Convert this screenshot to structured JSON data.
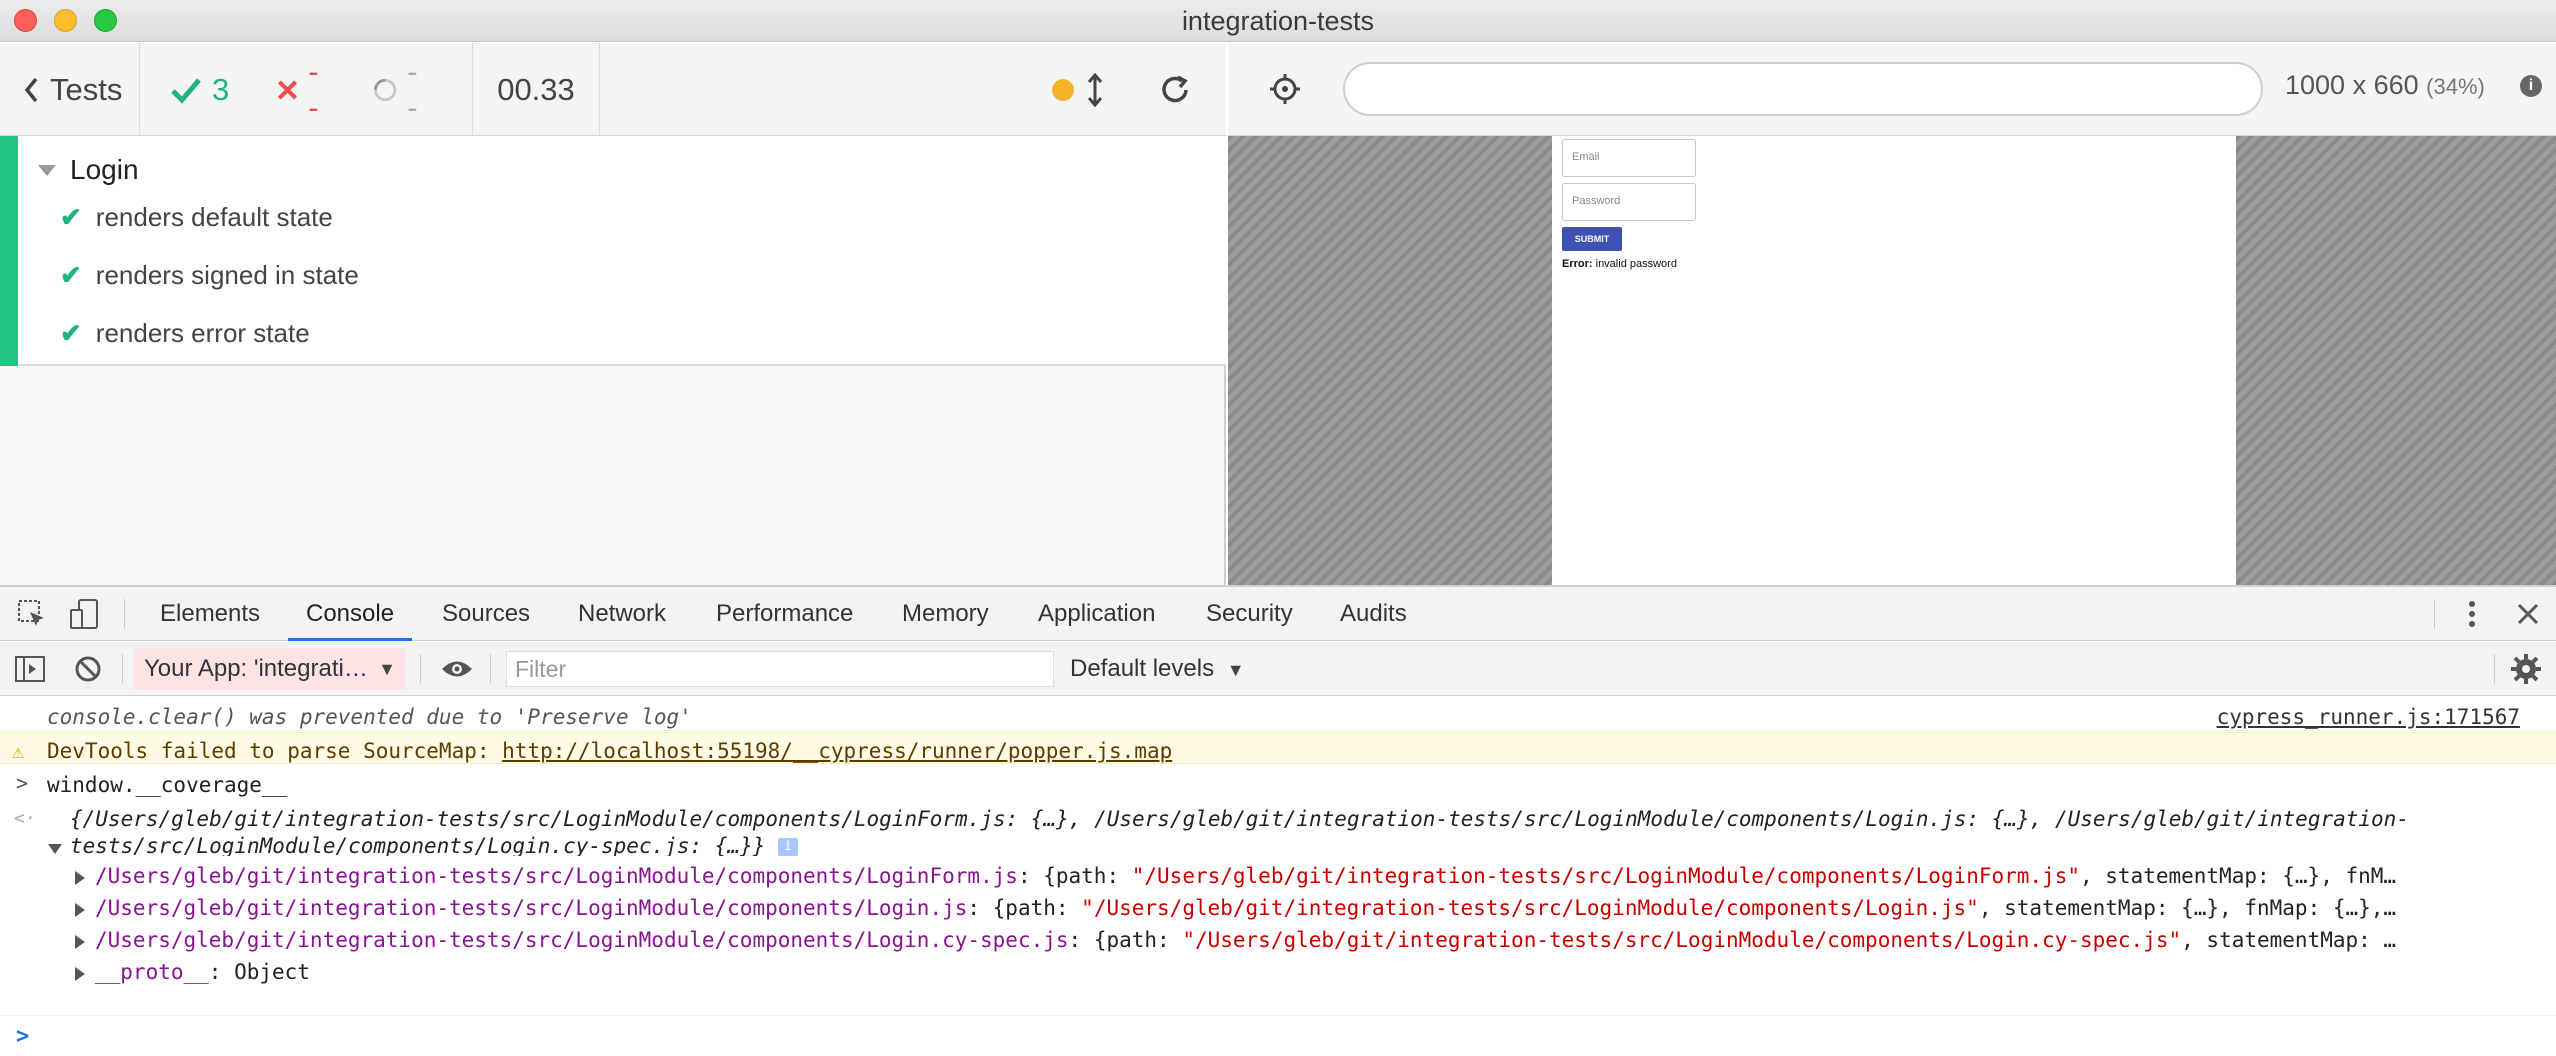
{
  "window": {
    "title": "integration-tests"
  },
  "reporter": {
    "back_label": "Tests",
    "passed": "3",
    "failed": "--",
    "pending": "--",
    "duration": "00.33",
    "suite": {
      "title": "Login",
      "tests": [
        "renders default state",
        "renders signed in state",
        "renders error state"
      ]
    }
  },
  "aut": {
    "url": "",
    "viewport": "1000 x 660",
    "scale": "(34%)",
    "app": {
      "email_placeholder": "Email",
      "password_placeholder": "Password",
      "submit_label": "SUBMIT",
      "error_label": "Error:",
      "error_text": "invalid password"
    }
  },
  "devtools": {
    "tabs": [
      "Elements",
      "Console",
      "Sources",
      "Network",
      "Performance",
      "Memory",
      "Application",
      "Security",
      "Audits"
    ],
    "active_tab": "Console",
    "context": "Your App: 'integrati…",
    "filter_placeholder": "Filter",
    "levels": "Default levels",
    "console": {
      "clear_msg": "console.clear() was prevented due to 'Preserve log'",
      "clear_src": "cypress_runner.js:171567",
      "warn_prefix": "DevTools failed to parse SourceMap: ",
      "warn_url": "http://localhost:55198/__cypress/runner/popper.js.map",
      "input": "window.__coverage__",
      "output_summary": "{/Users/gleb/git/integration-tests/src/LoginModule/components/LoginForm.js: {…}, /Users/gleb/git/integration-tests/src/LoginModule/components/Login.js: {…}, /Users/gleb/git/integration-tests/src/LoginModule/components/Login.cy-spec.js: {…}}",
      "props": [
        {
          "key": "/Users/gleb/git/integration-tests/src/LoginModule/components/LoginForm.js",
          "pre": ": {path: ",
          "path": "\"/Users/gleb/git/integration-tests/src/LoginModule/components/LoginForm.js\"",
          "post": ", statementMap: {…}, fnM…"
        },
        {
          "key": "/Users/gleb/git/integration-tests/src/LoginModule/components/Login.js",
          "pre": ": {path: ",
          "path": "\"/Users/gleb/git/integration-tests/src/LoginModule/components/Login.js\"",
          "post": ", statementMap: {…}, fnMap: {…},…"
        },
        {
          "key": "/Users/gleb/git/integration-tests/src/LoginModule/components/Login.cy-spec.js",
          "pre": ": {path: ",
          "path": "\"/Users/gleb/git/integration-tests/src/LoginModule/components/Login.cy-spec.js\"",
          "post": ", statementMap: …"
        }
      ],
      "proto_key": "__proto__",
      "proto_val": ": Object"
    }
  }
}
